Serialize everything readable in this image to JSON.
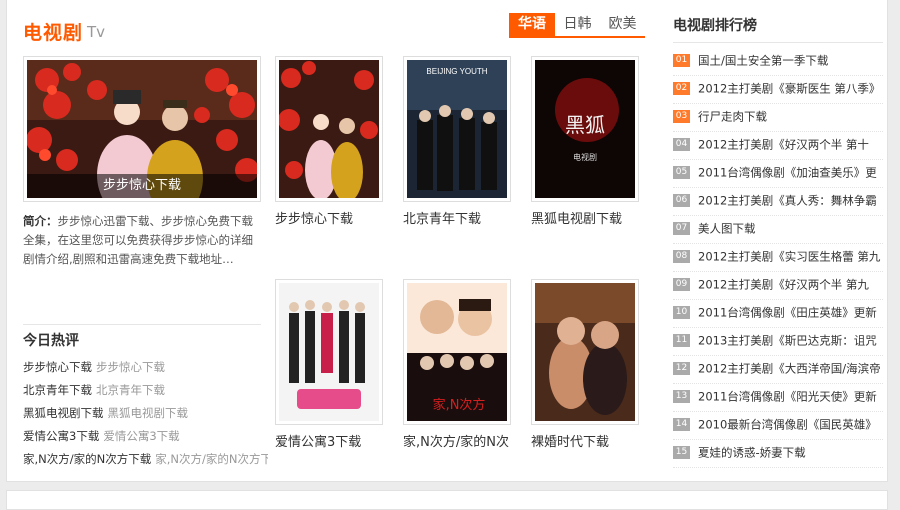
{
  "header": {
    "title": "电视剧",
    "subtitle": "Tv",
    "tabs": [
      {
        "label": "华语",
        "active": true
      },
      {
        "label": "日韩",
        "active": false
      },
      {
        "label": "欧美",
        "active": false
      }
    ]
  },
  "featured": {
    "caption": "步步惊心下载",
    "intro_label": "简介：",
    "intro_text": "步步惊心迅雷下载、步步惊心免费下载全集，在这里您可以免费获得步步惊心的详细剧情介绍,剧照和迅雷高速免费下载地址…"
  },
  "thumbs": [
    {
      "label": "步步惊心下载"
    },
    {
      "label": "北京青年下载",
      "poster_text": "BEIJING YOUTH"
    },
    {
      "label": "黑狐电视剧下载",
      "poster_text": "黑狐",
      "poster_sub": "电视剧"
    },
    {
      "label": "爱情公寓3下载"
    },
    {
      "label": "家,N次方/家的N次",
      "poster_text": "家,N次方"
    },
    {
      "label": "裸婚时代下载"
    }
  ],
  "hot": {
    "title": "今日热评",
    "items": [
      {
        "t1": "步步惊心下载",
        "t2": "步步惊心下载"
      },
      {
        "t1": "北京青年下载",
        "t2": "北京青年下载"
      },
      {
        "t1": "黑狐电视剧下载",
        "t2": "黑狐电视剧下载"
      },
      {
        "t1": "爱情公寓3下载",
        "t2": "爱情公寓3下载"
      },
      {
        "t1": "家,N次方/家的N次方下载",
        "t2": "家,N次方/家的N次方下"
      }
    ]
  },
  "ranking": {
    "title": "电视剧排行榜",
    "items": [
      {
        "num": "01",
        "text": "国土/国土安全第一季下载"
      },
      {
        "num": "02",
        "text": "2012主打美剧《豪斯医生 第八季》"
      },
      {
        "num": "03",
        "text": "行尸走肉下载"
      },
      {
        "num": "04",
        "text": "2012主打美剧《好汉两个半 第十"
      },
      {
        "num": "05",
        "text": "2011台湾偶像剧《加油查美乐》更"
      },
      {
        "num": "06",
        "text": "2012主打美剧《真人秀：舞林争霸"
      },
      {
        "num": "07",
        "text": "美人图下载"
      },
      {
        "num": "08",
        "text": "2012主打美剧《实习医生格蕾 第九"
      },
      {
        "num": "09",
        "text": "2012主打美剧《好汉两个半 第九"
      },
      {
        "num": "10",
        "text": "2011台湾偶像剧《田庄英雄》更新"
      },
      {
        "num": "11",
        "text": "2013主打美剧《斯巴达克斯：诅咒"
      },
      {
        "num": "12",
        "text": "2012主打美剧《大西洋帝国/海滨帝"
      },
      {
        "num": "13",
        "text": "2011台湾偶像剧《阳光天使》更新"
      },
      {
        "num": "14",
        "text": "2010最新台湾偶像剧《国民英雄》"
      },
      {
        "num": "15",
        "text": "夏娃的诱惑-娇妻下载"
      }
    ]
  },
  "colors": {
    "accent": "#ff5a00",
    "rank_hot": "#ff7a2a",
    "rank_normal": "#aaaaaa"
  }
}
